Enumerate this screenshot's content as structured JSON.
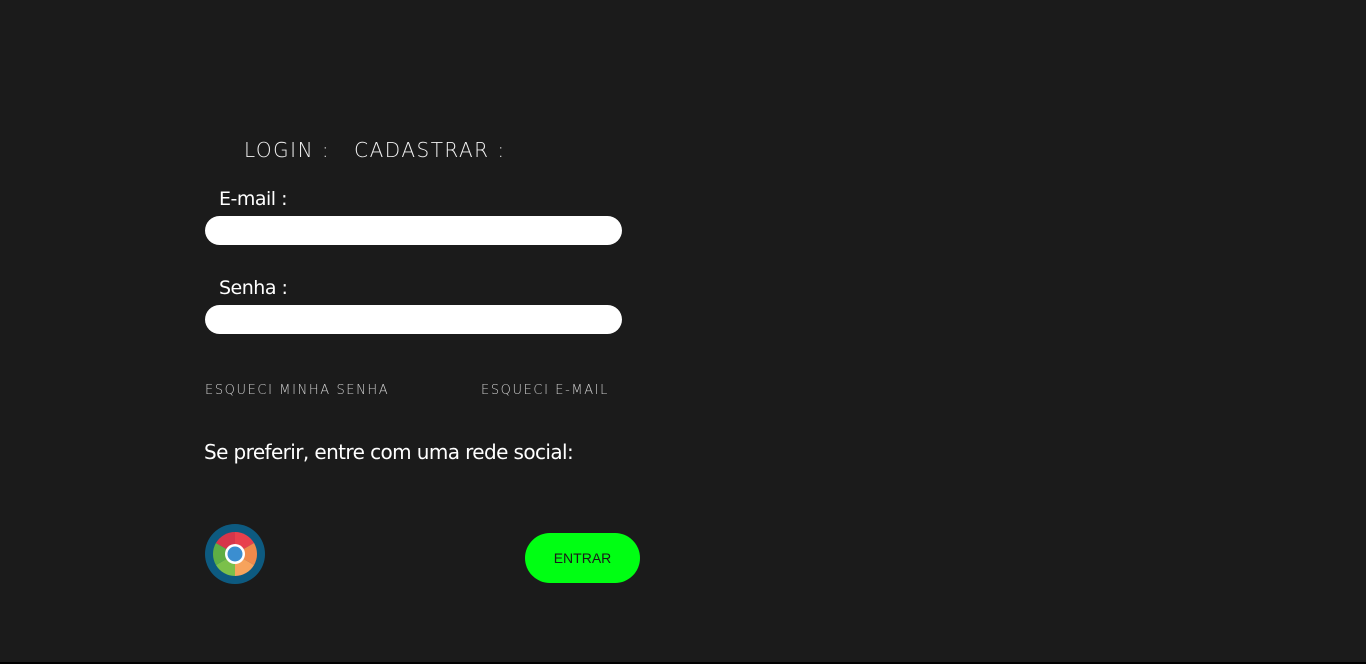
{
  "tabs": {
    "login": "LOGIN :",
    "cadastrar": "CADASTRAR :"
  },
  "form": {
    "email_label": "E-mail :",
    "email_value": "",
    "senha_label": "Senha :",
    "senha_value": ""
  },
  "links": {
    "forgot_password": "ESQUECI MINHA SENHA",
    "forgot_email": "ESQUECI E-MAIL"
  },
  "social": {
    "prompt": "Se preferir, entre com uma rede social:",
    "icon": "chrome-icon"
  },
  "actions": {
    "enter_label": "ENTRAR"
  },
  "colors": {
    "background": "#1b1b1b",
    "accent": "#00ff13",
    "field": "#ffffff"
  }
}
